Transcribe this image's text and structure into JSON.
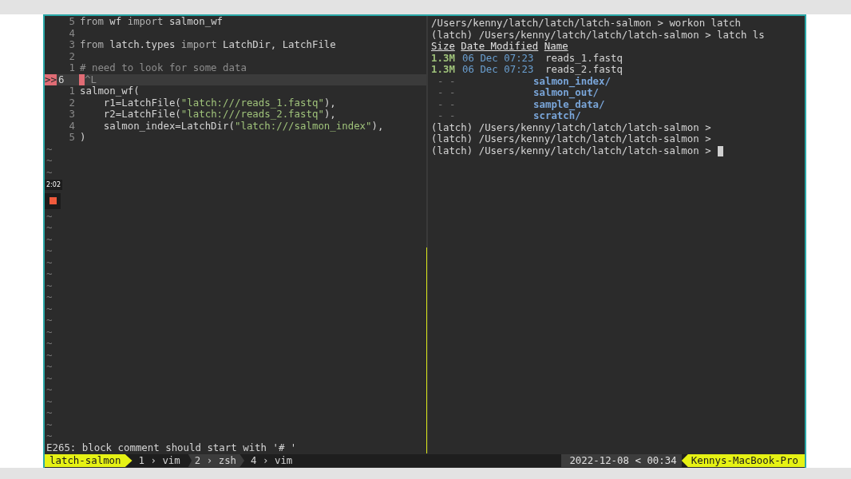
{
  "editor": {
    "lines": [
      {
        "number": "5",
        "tokens": [
          {
            "text": "from",
            "kind": "keyword"
          },
          {
            "text": " wf ",
            "kind": "plain"
          },
          {
            "text": "import",
            "kind": "keyword"
          },
          {
            "text": " salmon_wf",
            "kind": "plain"
          }
        ]
      },
      {
        "number": "4"
      },
      {
        "number": "3",
        "tokens": [
          {
            "text": "from",
            "kind": "keyword"
          },
          {
            "text": " latch.types ",
            "kind": "plain"
          },
          {
            "text": "import",
            "kind": "keyword"
          },
          {
            "text": " LatchDir, LatchFile",
            "kind": "plain"
          }
        ]
      },
      {
        "number": "2"
      },
      {
        "number": "1",
        "tokens": [
          {
            "text": "# need to look for some data",
            "kind": "comment"
          }
        ]
      },
      {
        "number": "6",
        "sign": ">>",
        "current": true,
        "tokens": [
          {
            "text": "^L",
            "kind": "special"
          }
        ]
      },
      {
        "number": "1",
        "tokens": [
          {
            "text": "salmon_wf(",
            "kind": "plain"
          }
        ]
      },
      {
        "number": "2",
        "tokens": [
          {
            "text": "    r1=LatchFile(",
            "kind": "plain"
          },
          {
            "text": "\"latch:///reads_1.fastq\"",
            "kind": "string"
          },
          {
            "text": "),",
            "kind": "plain"
          }
        ]
      },
      {
        "number": "3",
        "tokens": [
          {
            "text": "    r2=LatchFile(",
            "kind": "plain"
          },
          {
            "text": "\"latch:///reads_2.fastq\"",
            "kind": "string"
          },
          {
            "text": "),",
            "kind": "plain"
          }
        ]
      },
      {
        "number": "4",
        "tokens": [
          {
            "text": "    salmon_index=LatchDir(",
            "kind": "plain"
          },
          {
            "text": "\"latch:///salmon_index\"",
            "kind": "string"
          },
          {
            "text": "),",
            "kind": "plain"
          }
        ]
      },
      {
        "number": "5",
        "tokens": [
          {
            "text": ")",
            "kind": "plain"
          }
        ]
      }
    ],
    "tildes_before": [
      "~",
      "~",
      "~"
    ],
    "recording": {
      "time": "2:02"
    },
    "tildes_after": [
      "~",
      "~",
      "~",
      "~",
      "~",
      "~",
      "~",
      "~",
      "~",
      "~",
      "~",
      "~",
      "~",
      "~",
      "~",
      "~",
      "~",
      "~",
      "~",
      "~"
    ],
    "message": "E265: block comment should start with '# '"
  },
  "terminal": {
    "lines": [
      {
        "kind": "text",
        "text": "/Users/kenny/latch/latch/latch-salmon > workon latch"
      },
      {
        "kind": "text",
        "text": "(latch) /Users/kenny/latch/latch/latch-salmon > latch ls"
      },
      {
        "kind": "header",
        "columns": [
          "Size",
          "Date Modified",
          "Name"
        ]
      },
      {
        "kind": "file",
        "size": "1.3M",
        "date": "06 Dec 07:23",
        "name": "reads_1.fastq"
      },
      {
        "kind": "file",
        "size": "1.3M",
        "date": "06 Dec 07:23",
        "name": "reads_2.fastq"
      },
      {
        "kind": "dir",
        "size": "- -",
        "name": "salmon_index/"
      },
      {
        "kind": "dir",
        "size": "- -",
        "name": "salmon_out/"
      },
      {
        "kind": "dir",
        "size": "- -",
        "name": "sample_data/"
      },
      {
        "kind": "dir",
        "size": "- -",
        "name": "scratch/"
      },
      {
        "kind": "text",
        "text": "(latch) /Users/kenny/latch/latch/latch-salmon >"
      },
      {
        "kind": "text",
        "text": "(latch) /Users/kenny/latch/latch/latch-salmon >"
      },
      {
        "kind": "text",
        "text": "(latch) /Users/kenny/latch/latch/latch-salmon >",
        "cursor": true
      }
    ]
  },
  "status_bar": {
    "session": "latch-salmon",
    "windows": [
      {
        "index": "1",
        "arrow": "›",
        "name": "vim",
        "selected": false
      },
      {
        "index": "2",
        "arrow": "›",
        "name": "zsh",
        "selected": true
      },
      {
        "index": "4",
        "arrow": "›",
        "name": "vim",
        "selected": false
      }
    ],
    "date": "2022-12-08",
    "separator": "<",
    "time": "00:34",
    "host": "Kennys-MacBook-Pro"
  }
}
